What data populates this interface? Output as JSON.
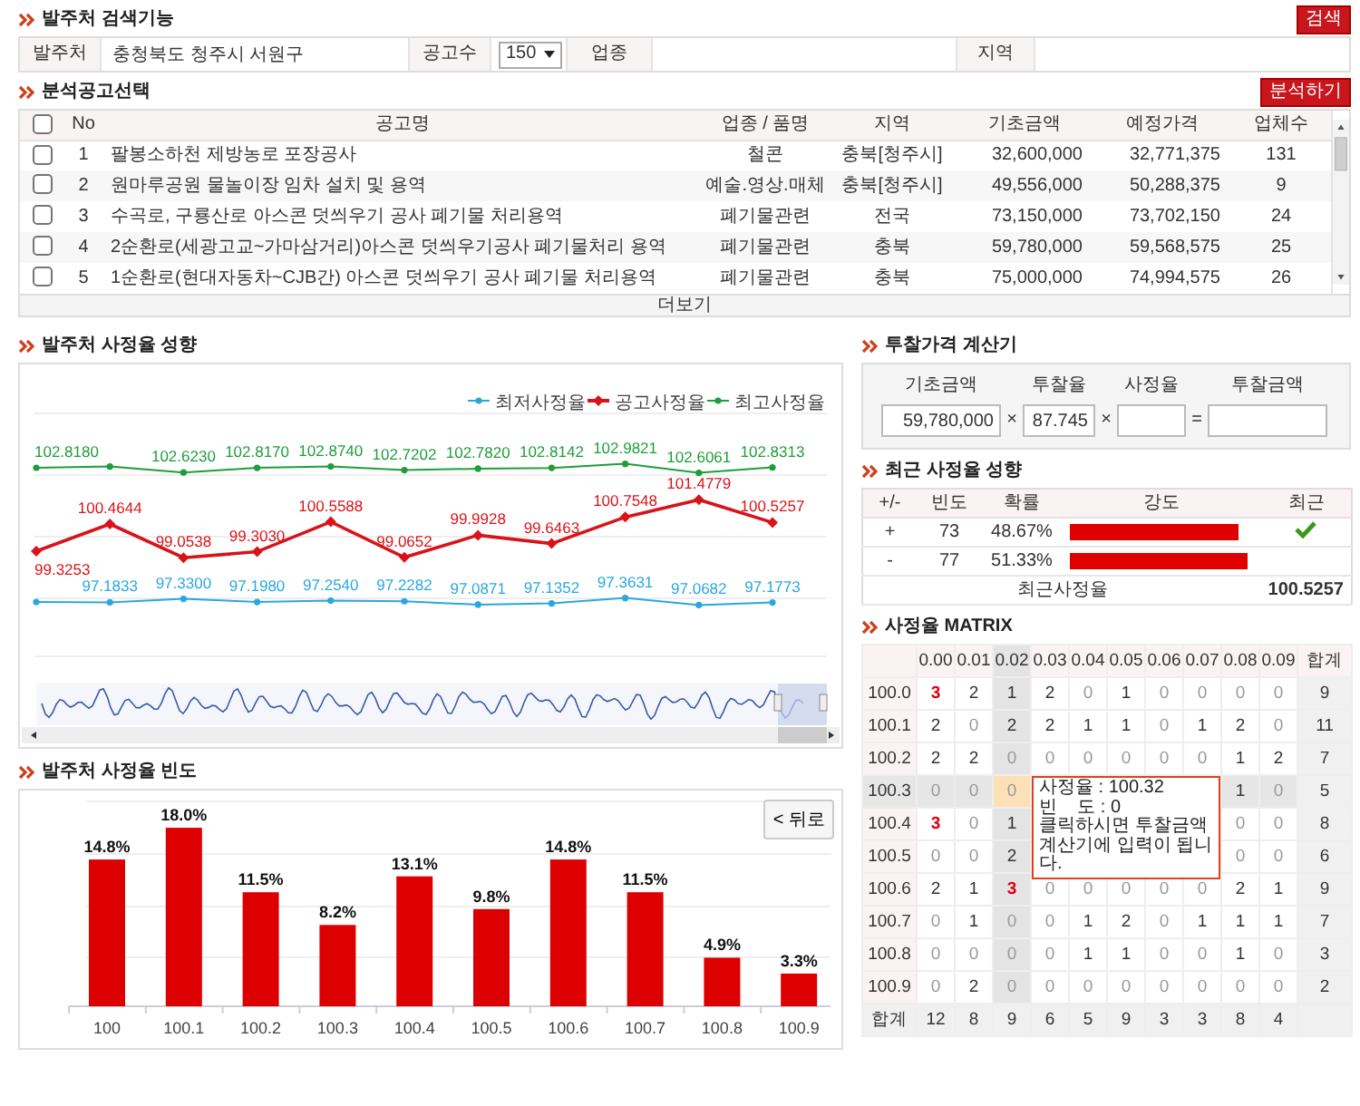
{
  "search": {
    "title": "발주처 검색기능",
    "button": "검색",
    "fields": [
      {
        "label": "발주처",
        "kind": "text",
        "value": "충청북도 청주시 서원구"
      },
      {
        "label": "공고수",
        "kind": "select",
        "value": "150"
      },
      {
        "label": "업종",
        "kind": "text"
      },
      {
        "label": "지역",
        "kind": "text"
      }
    ]
  },
  "notices": {
    "title": "분석공고선택",
    "button": "분석하기",
    "header_checked": false,
    "columns": [
      "No",
      "공고명",
      "업종 / 품명",
      "지역",
      "기초금액",
      "예정가격",
      "업체수"
    ],
    "rows": [
      {
        "checked": false,
        "cells": [
          "1",
          "팔봉소하천 제방농로 포장공사",
          "철콘",
          "충북[청주시]",
          "32,600,000",
          "32,771,375",
          "131"
        ]
      },
      {
        "checked": false,
        "cells": [
          "2",
          "원마루공원 물놀이장 임차 설치 및 용역",
          "예술.영상.매체",
          "충북[청주시]",
          "49,556,000",
          "50,288,375",
          "9"
        ]
      },
      {
        "checked": false,
        "cells": [
          "3",
          "수곡로, 구룡산로 아스콘 덧씌우기 공사 폐기물 처리용역",
          "폐기물관련",
          "전국",
          "73,150,000",
          "73,702,150",
          "24"
        ]
      },
      {
        "checked": false,
        "cells": [
          "4",
          "2순환로(세광고교~가마삼거리)아스콘 덧씌우기공사 폐기물처리 용역",
          "폐기물관련",
          "충북",
          "59,780,000",
          "59,568,575",
          "25"
        ]
      },
      {
        "checked": false,
        "cells": [
          "5",
          "1순환로(현대자동차~CJB간) 아스콘 덧씌우기 공사 폐기물 처리용역",
          "폐기물관련",
          "충북",
          "75,000,000",
          "74,994,575",
          "26"
        ]
      }
    ],
    "more": "더보기"
  },
  "trend": {
    "title": "발주처 사정율 성향",
    "chart_data": {
      "type": "line",
      "legend": "top-right",
      "series": [
        {
          "name": "최저사정율",
          "color": "#2aa7e0",
          "marker": "circle",
          "values": [
            97.2,
            97.1833,
            97.33,
            97.198,
            97.254,
            97.2282,
            97.0871,
            97.1352,
            97.3631,
            97.0682,
            97.1773
          ],
          "value_labels": [
            null,
            "97.1833",
            "97.3300",
            "97.1980",
            "97.2540",
            "97.2282",
            "97.0871",
            "97.1352",
            "97.3631",
            "97.0682",
            "97.1773"
          ]
        },
        {
          "name": "공고사정율",
          "color": "#d7141a",
          "marker": "diamond",
          "values": [
            99.3253,
            100.4644,
            99.0538,
            99.303,
            100.5588,
            99.0652,
            99.9928,
            99.6463,
            100.7548,
            101.4779,
            100.5257
          ],
          "value_labels": [
            "99.3253",
            "100.4644",
            "99.0538",
            "99.3030",
            "100.5588",
            "99.0652",
            "99.9928",
            "99.6463",
            "100.7548",
            "101.4779",
            "100.5257"
          ]
        },
        {
          "name": "최고사정율",
          "color": "#1e9e3a",
          "marker": "circle",
          "values": [
            102.818,
            102.87,
            102.623,
            102.817,
            102.874,
            102.7202,
            102.782,
            102.8142,
            102.9821,
            102.6061,
            102.8313
          ],
          "value_labels": [
            "102.8180",
            null,
            "102.6230",
            "102.8170",
            "102.8740",
            "102.7202",
            "102.7820",
            "102.8142",
            "102.9821",
            "102.6061",
            "102.8313"
          ]
        }
      ]
    }
  },
  "frequency": {
    "title": "발주처 사정율 빈도",
    "back_button": "< 뒤로",
    "chart_data": {
      "type": "bar",
      "categories": [
        "100",
        "100.1",
        "100.2",
        "100.3",
        "100.4",
        "100.5",
        "100.6",
        "100.7",
        "100.8",
        "100.9"
      ],
      "values": [
        14.8,
        18.0,
        11.5,
        8.2,
        13.1,
        9.8,
        14.8,
        11.5,
        4.9,
        3.3
      ],
      "value_labels": [
        "14.8%",
        "18.0%",
        "11.5%",
        "8.2%",
        "13.1%",
        "9.8%",
        "14.8%",
        "11.5%",
        "4.9%",
        "3.3%"
      ]
    }
  },
  "calculator": {
    "title": "투찰가격 계산기",
    "operators": [
      "×",
      "×",
      "="
    ],
    "fields": [
      {
        "label": "기초금액",
        "value": "59,780,000"
      },
      {
        "label": "투찰율",
        "value": "87.745"
      },
      {
        "label": "사정율"
      },
      {
        "label": "투찰금액"
      }
    ]
  },
  "recent": {
    "title": "최근 사정율 성향",
    "columns": [
      "+/-",
      "빈도",
      "확률",
      "강도",
      "최근"
    ],
    "rows": [
      {
        "sign": "+",
        "count": "73",
        "ratio": "48.67%",
        "level": 0.92,
        "recent": true
      },
      {
        "sign": "-",
        "count": "77",
        "ratio": "51.33%",
        "level": 0.97,
        "recent": false
      }
    ],
    "footer": {
      "label": "최근사정율",
      "value": "100.5257"
    }
  },
  "matrix": {
    "title": "사정율 MATRIX",
    "total_header": "합계",
    "totals_label": "합계",
    "columns": [
      {
        "label": "0.00",
        "selected": false
      },
      {
        "label": "0.01",
        "selected": false
      },
      {
        "label": "0.02",
        "selected": true
      },
      {
        "label": "0.03",
        "selected": false
      },
      {
        "label": "0.04",
        "selected": false
      },
      {
        "label": "0.05",
        "selected": false
      },
      {
        "label": "0.06",
        "selected": false
      },
      {
        "label": "0.07",
        "selected": false
      },
      {
        "label": "0.08",
        "selected": false
      },
      {
        "label": "0.09",
        "selected": false
      }
    ],
    "rows": [
      {
        "label": "100.0",
        "selected": false,
        "total": "9",
        "cells": [
          {
            "value": "3",
            "hot": true,
            "dimmed": false
          },
          {
            "value": "2",
            "hot": false,
            "dimmed": false
          },
          {
            "value": "1",
            "hot": false,
            "dimmed": false
          },
          {
            "value": "2",
            "hot": false,
            "dimmed": false
          },
          {
            "value": "0",
            "hot": false,
            "dimmed": true
          },
          {
            "value": "1",
            "hot": false,
            "dimmed": false
          },
          {
            "value": "0",
            "hot": false,
            "dimmed": true
          },
          {
            "value": "0",
            "hot": false,
            "dimmed": true
          },
          {
            "value": "0",
            "hot": false,
            "dimmed": true
          },
          {
            "value": "0",
            "hot": false,
            "dimmed": true
          }
        ]
      },
      {
        "label": "100.1",
        "selected": false,
        "total": "11",
        "cells": [
          {
            "value": "2",
            "hot": false,
            "dimmed": false
          },
          {
            "value": "0",
            "hot": false,
            "dimmed": true
          },
          {
            "value": "2",
            "hot": false,
            "dimmed": false
          },
          {
            "value": "2",
            "hot": false,
            "dimmed": false
          },
          {
            "value": "1",
            "hot": false,
            "dimmed": false
          },
          {
            "value": "1",
            "hot": false,
            "dimmed": false
          },
          {
            "value": "0",
            "hot": false,
            "dimmed": true
          },
          {
            "value": "1",
            "hot": false,
            "dimmed": false
          },
          {
            "value": "2",
            "hot": false,
            "dimmed": false
          },
          {
            "value": "0",
            "hot": false,
            "dimmed": true
          }
        ]
      },
      {
        "label": "100.2",
        "selected": false,
        "total": "7",
        "cells": [
          {
            "value": "2",
            "hot": false,
            "dimmed": false
          },
          {
            "value": "2",
            "hot": false,
            "dimmed": false
          },
          {
            "value": "0",
            "hot": false,
            "dimmed": true
          },
          {
            "value": "0",
            "hot": false,
            "dimmed": true
          },
          {
            "value": "0",
            "hot": false,
            "dimmed": true
          },
          {
            "value": "0",
            "hot": false,
            "dimmed": true
          },
          {
            "value": "0",
            "hot": false,
            "dimmed": true
          },
          {
            "value": "0",
            "hot": false,
            "dimmed": true
          },
          {
            "value": "1",
            "hot": false,
            "dimmed": false
          },
          {
            "value": "2",
            "hot": false,
            "dimmed": false
          }
        ]
      },
      {
        "label": "100.3",
        "selected": true,
        "total": "5",
        "cells": [
          {
            "value": "0",
            "hot": false,
            "dimmed": true
          },
          {
            "value": "0",
            "hot": false,
            "dimmed": true
          },
          {
            "value": "0",
            "hot": false,
            "dimmed": true
          },
          null,
          null,
          null,
          null,
          null,
          {
            "value": "1",
            "hot": false,
            "dimmed": false
          },
          {
            "value": "0",
            "hot": false,
            "dimmed": true
          }
        ]
      },
      {
        "label": "100.4",
        "selected": false,
        "total": "8",
        "cells": [
          {
            "value": "3",
            "hot": true,
            "dimmed": false
          },
          {
            "value": "0",
            "hot": false,
            "dimmed": true
          },
          {
            "value": "1",
            "hot": false,
            "dimmed": false
          },
          null,
          null,
          null,
          null,
          null,
          {
            "value": "0",
            "hot": false,
            "dimmed": true
          },
          {
            "value": "0",
            "hot": false,
            "dimmed": true
          }
        ]
      },
      {
        "label": "100.5",
        "selected": false,
        "total": "6",
        "cells": [
          {
            "value": "0",
            "hot": false,
            "dimmed": true
          },
          {
            "value": "0",
            "hot": false,
            "dimmed": true
          },
          {
            "value": "2",
            "hot": false,
            "dimmed": false
          },
          null,
          null,
          null,
          null,
          null,
          {
            "value": "0",
            "hot": false,
            "dimmed": true
          },
          {
            "value": "0",
            "hot": false,
            "dimmed": true
          }
        ]
      },
      {
        "label": "100.6",
        "selected": false,
        "total": "9",
        "cells": [
          {
            "value": "2",
            "hot": false,
            "dimmed": false
          },
          {
            "value": "1",
            "hot": false,
            "dimmed": false
          },
          {
            "value": "3",
            "hot": true,
            "dimmed": false
          },
          {
            "value": "0",
            "hot": false,
            "dimmed": true
          },
          {
            "value": "0",
            "hot": false,
            "dimmed": true
          },
          {
            "value": "0",
            "hot": false,
            "dimmed": true
          },
          {
            "value": "0",
            "hot": false,
            "dimmed": true
          },
          {
            "value": "0",
            "hot": false,
            "dimmed": true
          },
          {
            "value": "2",
            "hot": false,
            "dimmed": false
          },
          {
            "value": "1",
            "hot": false,
            "dimmed": false
          }
        ]
      },
      {
        "label": "100.7",
        "selected": false,
        "total": "7",
        "cells": [
          {
            "value": "0",
            "hot": false,
            "dimmed": true
          },
          {
            "value": "1",
            "hot": false,
            "dimmed": false
          },
          {
            "value": "0",
            "hot": false,
            "dimmed": true
          },
          {
            "value": "0",
            "hot": false,
            "dimmed": true
          },
          {
            "value": "1",
            "hot": false,
            "dimmed": false
          },
          {
            "value": "2",
            "hot": false,
            "dimmed": false
          },
          {
            "value": "0",
            "hot": false,
            "dimmed": true
          },
          {
            "value": "1",
            "hot": false,
            "dimmed": false
          },
          {
            "value": "1",
            "hot": false,
            "dimmed": false
          },
          {
            "value": "1",
            "hot": false,
            "dimmed": false
          }
        ]
      },
      {
        "label": "100.8",
        "selected": false,
        "total": "3",
        "cells": [
          {
            "value": "0",
            "hot": false,
            "dimmed": true
          },
          {
            "value": "0",
            "hot": false,
            "dimmed": true
          },
          {
            "value": "0",
            "hot": false,
            "dimmed": true
          },
          {
            "value": "0",
            "hot": false,
            "dimmed": true
          },
          {
            "value": "1",
            "hot": false,
            "dimmed": false
          },
          {
            "value": "1",
            "hot": false,
            "dimmed": false
          },
          {
            "value": "0",
            "hot": false,
            "dimmed": true
          },
          {
            "value": "0",
            "hot": false,
            "dimmed": true
          },
          {
            "value": "1",
            "hot": false,
            "dimmed": false
          },
          {
            "value": "0",
            "hot": false,
            "dimmed": true
          }
        ]
      },
      {
        "label": "100.9",
        "selected": false,
        "total": "2",
        "cells": [
          {
            "value": "0",
            "hot": false,
            "dimmed": true
          },
          {
            "value": "2",
            "hot": false,
            "dimmed": false
          },
          {
            "value": "0",
            "hot": false,
            "dimmed": true
          },
          {
            "value": "0",
            "hot": false,
            "dimmed": true
          },
          {
            "value": "0",
            "hot": false,
            "dimmed": true
          },
          {
            "value": "0",
            "hot": false,
            "dimmed": true
          },
          {
            "value": "0",
            "hot": false,
            "dimmed": true
          },
          {
            "value": "0",
            "hot": false,
            "dimmed": true
          },
          {
            "value": "0",
            "hot": false,
            "dimmed": true
          },
          {
            "value": "0",
            "hot": false,
            "dimmed": true
          }
        ]
      }
    ],
    "totals": [
      "12",
      "8",
      "9",
      "6",
      "5",
      "9",
      "3",
      "3",
      "8",
      "4"
    ],
    "tooltip": {
      "lines": [
        "사정율 : 100.32",
        "빈    도 : 0"
      ],
      "message": "클릭하시면 투찰금액 계산기에 입력이 됩니다."
    }
  }
}
